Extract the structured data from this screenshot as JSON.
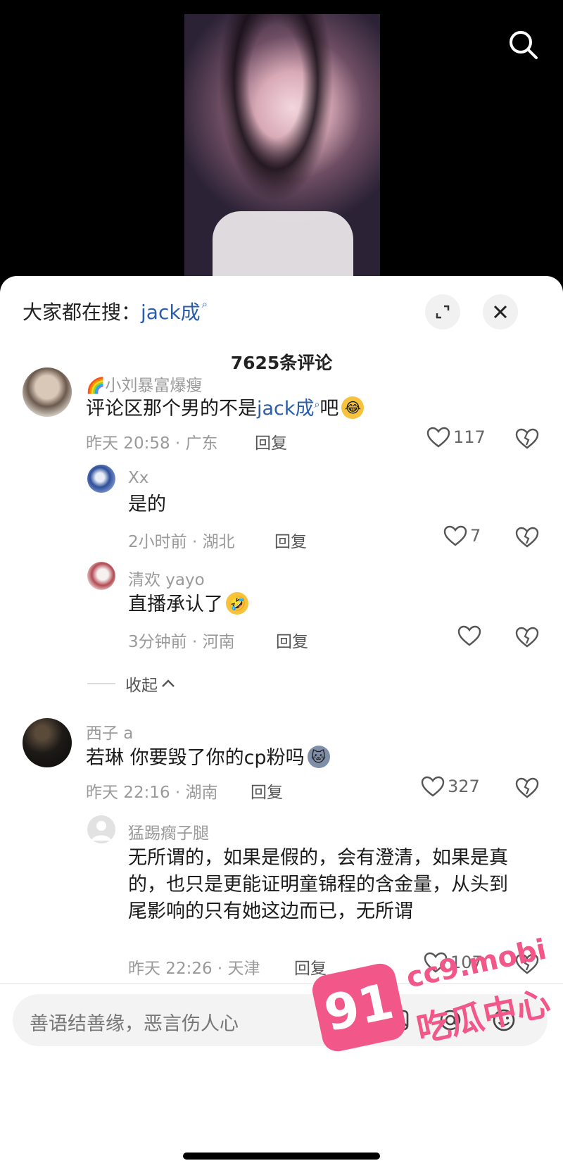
{
  "header": {
    "hot_search_prefix": "大家都在搜：",
    "hot_search_keyword": "jack成"
  },
  "comment_count_label": "7625条评论",
  "comments": [
    {
      "user": "小刘暴富爆瘦",
      "text_before": "评论区那个男的不是",
      "keyword": "jack成",
      "text_after": "吧",
      "time_location": "昨天 20:58 · 广东",
      "reply_label": "回复",
      "likes": "117"
    },
    {
      "user": "Xx",
      "text": "是的",
      "time_location": "2小时前 · 湖北",
      "reply_label": "回复",
      "likes": "7"
    },
    {
      "user": "清欢 yayo",
      "text": "直播承认了",
      "time_location": "3分钟前 · 河南",
      "reply_label": "回复",
      "likes": ""
    },
    {
      "user": "西子 a",
      "text": "若琳 你要毁了你的cp粉吗",
      "time_location": "昨天 22:16 · 湖南",
      "reply_label": "回复",
      "likes": "327"
    },
    {
      "user": "猛踢瘸子腿",
      "text": "无所谓的，如果是假的，会有澄清，如果是真的，也只是更能证明童锦程的含金量，从头到尾影响的只有她这边而已，无所谓",
      "time_location": "昨天 22:26 · 天津",
      "reply_label": "回复",
      "likes": "107"
    }
  ],
  "collapse_label": "收起",
  "input": {
    "placeholder": "善语结善缘，恶言伤人心"
  },
  "watermark": {
    "badge": "91",
    "site": "cc9.mobi",
    "name": "吃瓜中心"
  },
  "icons": {
    "search": "search-icon",
    "expand": "expand-icon",
    "close": "close-icon",
    "like": "heart-icon",
    "dislike": "broken-heart-icon",
    "image": "image-icon",
    "at": "at-icon",
    "emoji": "emoji-icon"
  },
  "colors": {
    "keyword": "#2b5da8",
    "watermark": "#f2578a"
  }
}
